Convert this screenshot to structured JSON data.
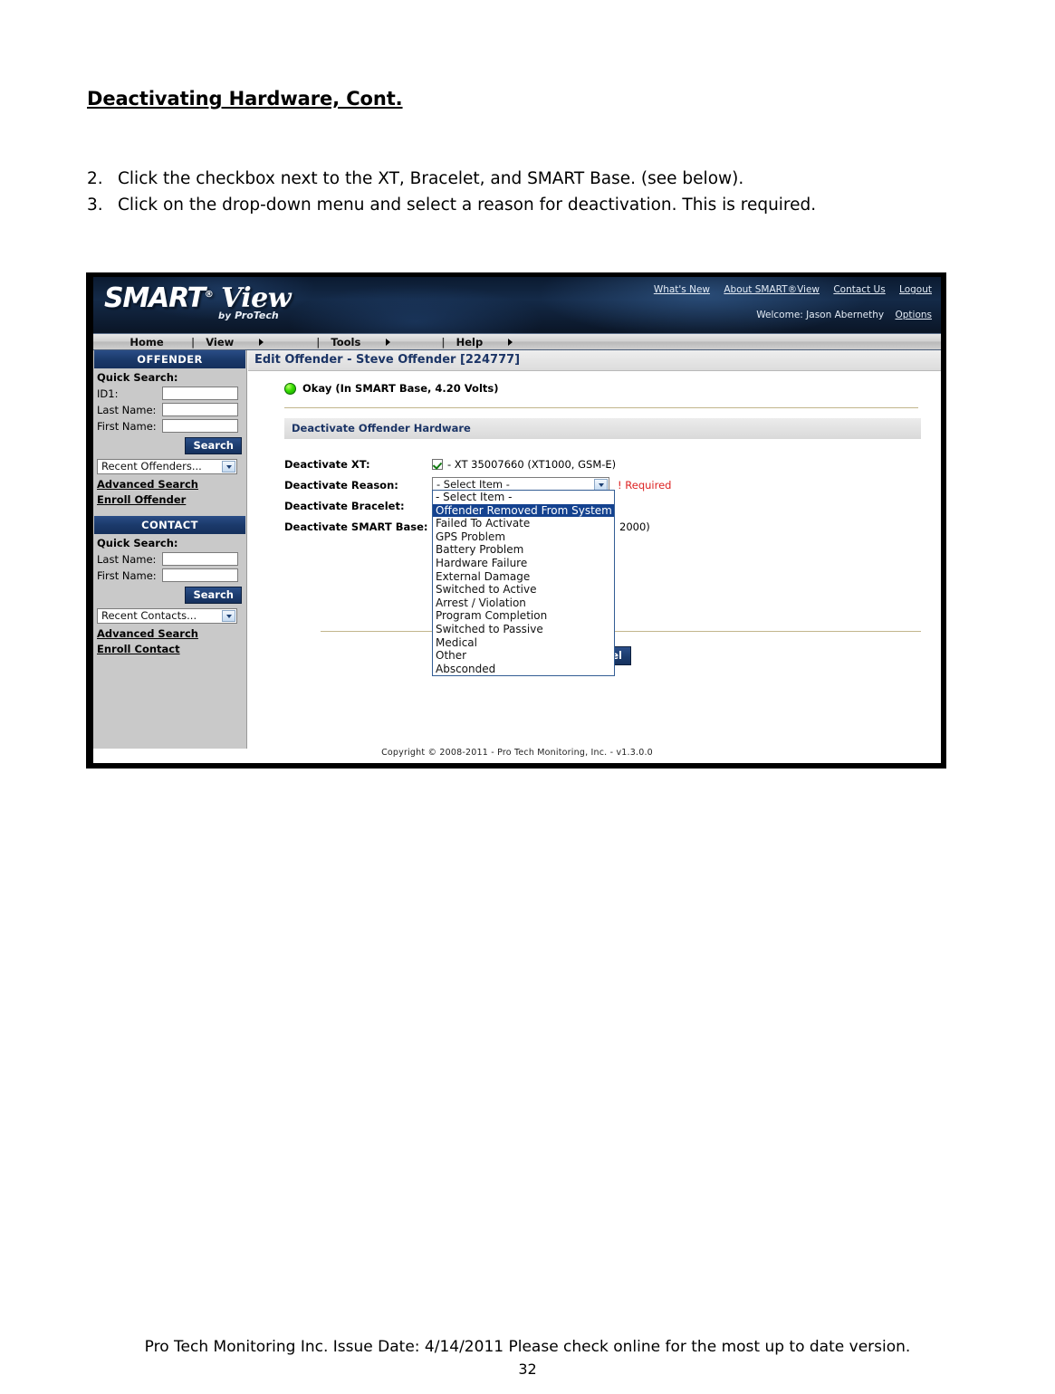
{
  "document": {
    "title": "Deactivating Hardware, Cont.",
    "steps": [
      {
        "num": "2.",
        "text": "Click the checkbox next to the XT, Bracelet, and SMART Base. (see below)."
      },
      {
        "num": "3.",
        "text": "Click on the drop-down menu and select a reason for deactivation. This is required."
      }
    ],
    "footer": "Pro Tech Monitoring Inc. Issue Date: 4/14/2011 Please check online for the most up to date version.",
    "page_number": "32"
  },
  "app": {
    "logo": {
      "smart": "SMART",
      "registered": "®",
      "view": "View",
      "by": "by",
      "brand": "ProTech"
    },
    "banner_links": [
      {
        "label": "What's New"
      },
      {
        "label": "About SMART®View"
      },
      {
        "label": "Contact Us"
      },
      {
        "label": "Logout"
      }
    ],
    "welcome": "Welcome: Jason Abernethy",
    "options_label": "Options",
    "menu": [
      {
        "label": "Home",
        "has_arrow": false
      },
      {
        "label": "View",
        "has_arrow": true
      },
      {
        "label": "Tools",
        "has_arrow": true
      },
      {
        "label": "Help",
        "has_arrow": true
      }
    ],
    "menu_separator": "|",
    "copyright": "Copyright © 2008-2011 - Pro Tech Monitoring, Inc. - v1.3.0.0"
  },
  "sidebar": {
    "offender": {
      "header": "OFFENDER",
      "quick_search_label": "Quick Search:",
      "fields": [
        {
          "label": "ID1:",
          "value": ""
        },
        {
          "label": "Last Name:",
          "value": ""
        },
        {
          "label": "First Name:",
          "value": ""
        }
      ],
      "search_button": "Search",
      "recent_select": "Recent Offenders...",
      "links": [
        {
          "label": "Advanced Search"
        },
        {
          "label": "Enroll Offender"
        }
      ]
    },
    "contact": {
      "header": "CONTACT",
      "quick_search_label": "Quick Search:",
      "fields": [
        {
          "label": "Last Name:",
          "value": ""
        },
        {
          "label": "First Name:",
          "value": ""
        }
      ],
      "search_button": "Search",
      "recent_select": "Recent Contacts...",
      "links": [
        {
          "label": "Advanced Search"
        },
        {
          "label": "Enroll Contact"
        }
      ]
    }
  },
  "main": {
    "page_title": "Edit Offender - Steve Offender [224777]",
    "status_text": "Okay (In SMART Base, 4.20 Volts)",
    "section_title": "Deactivate Offender Hardware",
    "rows": {
      "xt": {
        "label": "Deactivate XT:",
        "checked": true,
        "device": "- XT 35007660 (XT1000, GSM-E)"
      },
      "reason": {
        "label": "Deactivate Reason:",
        "selected": "- Select Item -",
        "required_text": "! Required"
      },
      "bracelet": {
        "label": "Deactivate Bracelet:"
      },
      "smart_base": {
        "label": "Deactivate SMART Base:",
        "device_tail": "2000)"
      }
    },
    "reason_options": [
      {
        "label": "- Select Item -",
        "selected": false
      },
      {
        "label": "Offender Removed From System",
        "selected": true
      },
      {
        "label": "Failed To Activate",
        "selected": false
      },
      {
        "label": "GPS Problem",
        "selected": false
      },
      {
        "label": "Battery Problem",
        "selected": false
      },
      {
        "label": "Hardware Failure",
        "selected": false
      },
      {
        "label": "External Damage",
        "selected": false
      },
      {
        "label": "Switched to Active",
        "selected": false
      },
      {
        "label": "Arrest / Violation",
        "selected": false
      },
      {
        "label": "Program Completion",
        "selected": false
      },
      {
        "label": "Switched to Passive",
        "selected": false
      },
      {
        "label": "Medical",
        "selected": false
      },
      {
        "label": "Other",
        "selected": false
      },
      {
        "label": "Absconded",
        "selected": false
      }
    ],
    "cancel_button": "Cancel"
  },
  "colors": {
    "brand_navy": "#1b3a6b",
    "accent_blue": "#14428f",
    "required_red": "#dd2222",
    "status_green": "#35dd00",
    "sidebar_gray": "#c9c9c9"
  }
}
